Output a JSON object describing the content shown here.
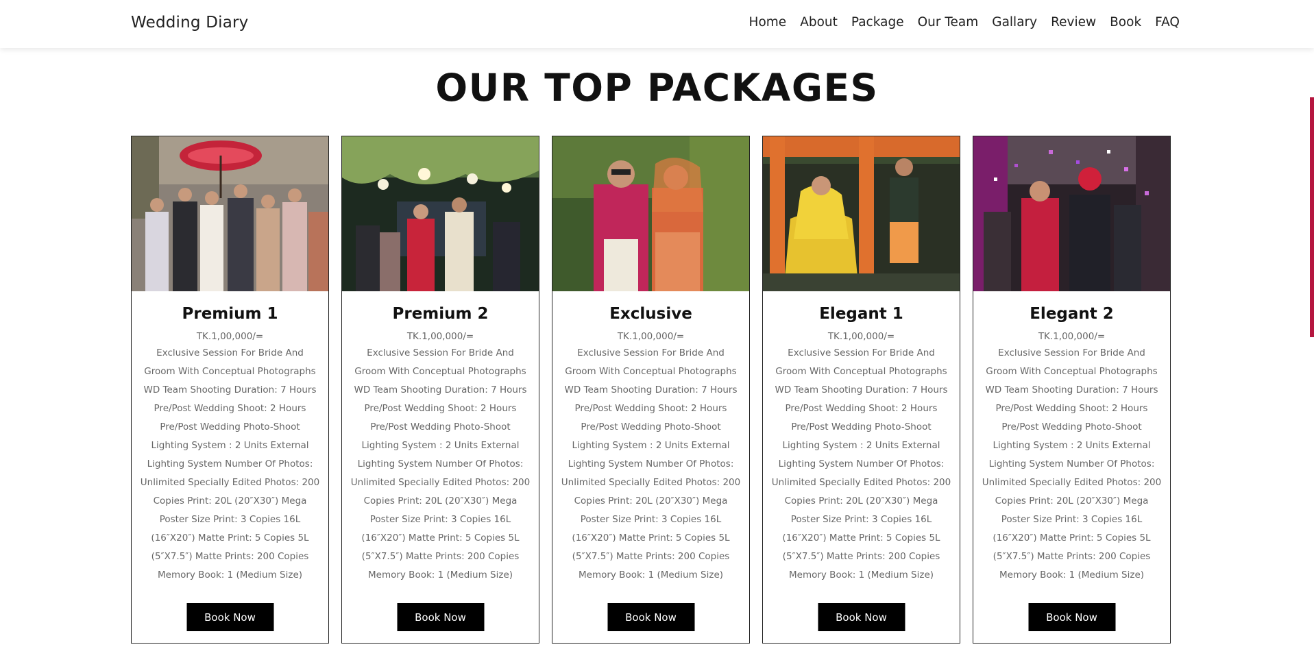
{
  "header": {
    "brand": "Wedding Diary",
    "nav": [
      "Home",
      "About",
      "Package",
      "Our Team",
      "Gallary",
      "Review",
      "Book",
      "FAQ"
    ]
  },
  "section": {
    "title": "OUR TOP PACKAGES"
  },
  "packages": [
    {
      "name": "Premium 1",
      "price": "TK.1,00,000/=",
      "description": "Exclusive Session For Bride And Groom With Conceptual Photographs WD Team Shooting Duration: 7 Hours Pre/Post Wedding Shoot: 2 Hours Pre/Post Wedding Photo-Shoot Lighting System : 2 Units External Lighting System Number Of Photos: Unlimited Specially Edited Photos: 200 Copies Print: 20L (20″X30″) Mega Poster Size Print: 3 Copies 16L (16″X20″) Matte Print: 5 Copies 5L (5″X7.5″) Matte Prints: 200 Copies Memory Book: 1 (Medium Size)",
      "button": "Book Now"
    },
    {
      "name": "Premium 2",
      "price": "TK.1,00,000/=",
      "description": "Exclusive Session For Bride And Groom With Conceptual Photographs WD Team Shooting Duration: 7 Hours Pre/Post Wedding Shoot: 2 Hours Pre/Post Wedding Photo-Shoot Lighting System : 2 Units External Lighting System Number Of Photos: Unlimited Specially Edited Photos: 200 Copies Print: 20L (20″X30″) Mega Poster Size Print: 3 Copies 16L (16″X20″) Matte Print: 5 Copies 5L (5″X7.5″) Matte Prints: 200 Copies Memory Book: 1 (Medium Size)",
      "button": "Book Now"
    },
    {
      "name": "Exclusive",
      "price": "TK.1,00,000/=",
      "description": "Exclusive Session For Bride And Groom With Conceptual Photographs WD Team Shooting Duration: 7 Hours Pre/Post Wedding Shoot: 2 Hours Pre/Post Wedding Photo-Shoot Lighting System : 2 Units External Lighting System Number Of Photos: Unlimited Specially Edited Photos: 200 Copies Print: 20L (20″X30″) Mega Poster Size Print: 3 Copies 16L (16″X20″) Matte Print: 5 Copies 5L (5″X7.5″) Matte Prints: 200 Copies Memory Book: 1 (Medium Size)",
      "button": "Book Now"
    },
    {
      "name": "Elegant 1",
      "price": "TK.1,00,000/=",
      "description": "Exclusive Session For Bride And Groom With Conceptual Photographs WD Team Shooting Duration: 7 Hours Pre/Post Wedding Shoot: 2 Hours Pre/Post Wedding Photo-Shoot Lighting System : 2 Units External Lighting System Number Of Photos: Unlimited Specially Edited Photos: 200 Copies Print: 20L (20″X30″) Mega Poster Size Print: 3 Copies 16L (16″X20″) Matte Print: 5 Copies 5L (5″X7.5″) Matte Prints: 200 Copies Memory Book: 1 (Medium Size)",
      "button": "Book Now"
    },
    {
      "name": "Elegant 2",
      "price": "TK.1,00,000/=",
      "description": "Exclusive Session For Bride And Groom With Conceptual Photographs WD Team Shooting Duration: 7 Hours Pre/Post Wedding Shoot: 2 Hours Pre/Post Wedding Photo-Shoot Lighting System : 2 Units External Lighting System Number Of Photos: Unlimited Specially Edited Photos: 200 Copies Print: 20L (20″X30″) Mega Poster Size Print: 3 Copies 16L (16″X20″) Matte Print: 5 Copies 5L (5″X7.5″) Matte Prints: 200 Copies Memory Book: 1 (Medium Size)",
      "button": "Book Now"
    }
  ],
  "colors": {
    "accent": "#b5163f",
    "button_bg": "#000000",
    "text_muted": "#666666"
  }
}
